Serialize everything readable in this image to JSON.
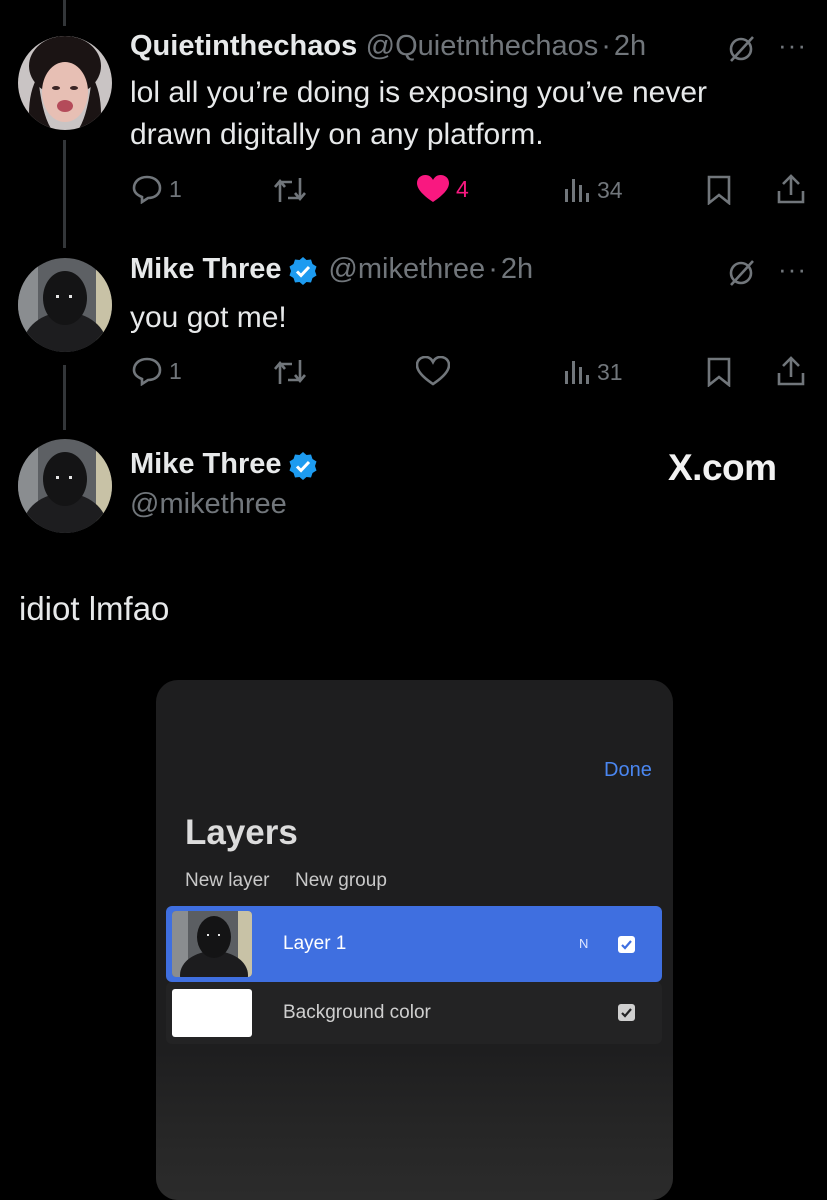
{
  "tweets": [
    {
      "name": "Quietinthechaos",
      "handle": "@Quietnthechaos",
      "sep": "·",
      "time": "2h",
      "text_line1": "lol all you’re doing is exposing you’ve never",
      "text_line2": "drawn digitally on any platform.",
      "replies": "1",
      "likes": "4",
      "views": "34",
      "liked": true
    },
    {
      "name": "Mike Three",
      "handle": "@mikethree",
      "sep": "·",
      "time": "2h",
      "text": "you got me!",
      "replies": "1",
      "views": "31",
      "verified": true
    }
  ],
  "main_tweet": {
    "name": "Mike Three",
    "handle": "@mikethree",
    "watermark": "X.com",
    "text": "idiot lmfao",
    "verified": true
  },
  "layers_panel": {
    "done": "Done",
    "title": "Layers",
    "new_layer": "New layer",
    "new_group": "New group",
    "layers": [
      {
        "name": "Layer 1",
        "blend_mode": "N",
        "visible": true,
        "selected": true
      },
      {
        "name": "Background color",
        "visible": true,
        "selected": false
      }
    ]
  },
  "colors": {
    "like_pink": "#f91880",
    "verified_blue": "#1d9bf0",
    "link_blue": "#4a86f0",
    "selected_row": "#3f6fe0"
  },
  "icons": [
    "reply-icon",
    "retweet-icon",
    "heart-icon",
    "views-icon",
    "bookmark-icon",
    "share-icon",
    "mute-icon",
    "more-icon",
    "verified-badge-icon"
  ]
}
